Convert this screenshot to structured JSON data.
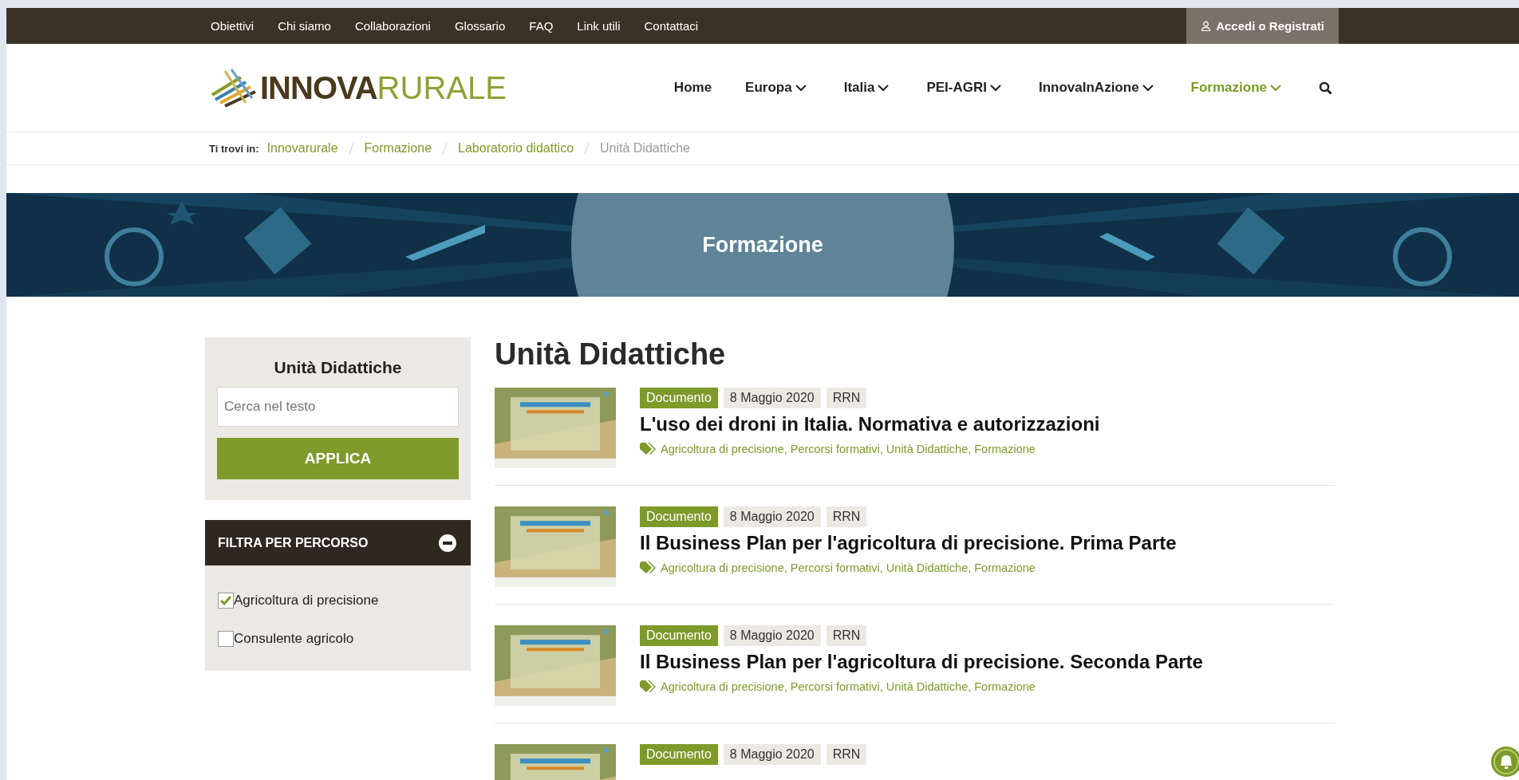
{
  "top_links": [
    "Obiettivi",
    "Chi siamo",
    "Collaborazioni",
    "Glossario",
    "FAQ",
    "Link utili",
    "Contattaci"
  ],
  "login": "Accedi o Registrati",
  "logo": {
    "bold": "INNOVA",
    "light": "RURALE"
  },
  "nav": [
    {
      "label": "Home",
      "dropdown": false,
      "selected": false
    },
    {
      "label": "Europa",
      "dropdown": true,
      "selected": false
    },
    {
      "label": "Italia",
      "dropdown": true,
      "selected": false
    },
    {
      "label": "PEI-AGRI",
      "dropdown": true,
      "selected": false
    },
    {
      "label": "InnovaInAzione",
      "dropdown": true,
      "selected": false
    },
    {
      "label": "Formazione",
      "dropdown": true,
      "selected": true
    }
  ],
  "breadcrumb": {
    "label": "Ti trovi in:",
    "items": [
      "Innovarurale",
      "Formazione",
      "Laboratorio didattico",
      "Unità Didattiche"
    ]
  },
  "banner": {
    "title": "Formazione"
  },
  "sidebar": {
    "title": "Unità Didattiche",
    "search": {
      "placeholder": "Cerca nel testo"
    },
    "apply": "APPLICA",
    "filter": {
      "title": "FILTRA PER PERCORSO",
      "expanded": true,
      "options": [
        {
          "label": "Agricoltura di precisione",
          "checked": true
        },
        {
          "label": "Consulente agricolo",
          "checked": false
        }
      ]
    }
  },
  "main": {
    "title": "Unità Didattiche",
    "items": [
      {
        "type": "Documento",
        "date": "8 Maggio 2020",
        "source": "RRN",
        "title": "L'uso dei droni in Italia. Normativa e autorizzazioni",
        "tags": "Agricoltura di precisione, Percorsi formativi, Unità Didattiche, Formazione"
      },
      {
        "type": "Documento",
        "date": "8 Maggio 2020",
        "source": "RRN",
        "title": "Il Business Plan per l'agricoltura di precisione. Prima Parte",
        "tags": "Agricoltura di precisione, Percorsi formativi, Unità Didattiche, Formazione"
      },
      {
        "type": "Documento",
        "date": "8 Maggio 2020",
        "source": "RRN",
        "title": "Il Business Plan per l'agricoltura di precisione. Seconda Parte",
        "tags": "Agricoltura di precisione, Percorsi formativi, Unità Didattiche, Formazione"
      },
      {
        "type": "Documento",
        "date": "8 Maggio 2020",
        "source": "RRN"
      }
    ]
  }
}
